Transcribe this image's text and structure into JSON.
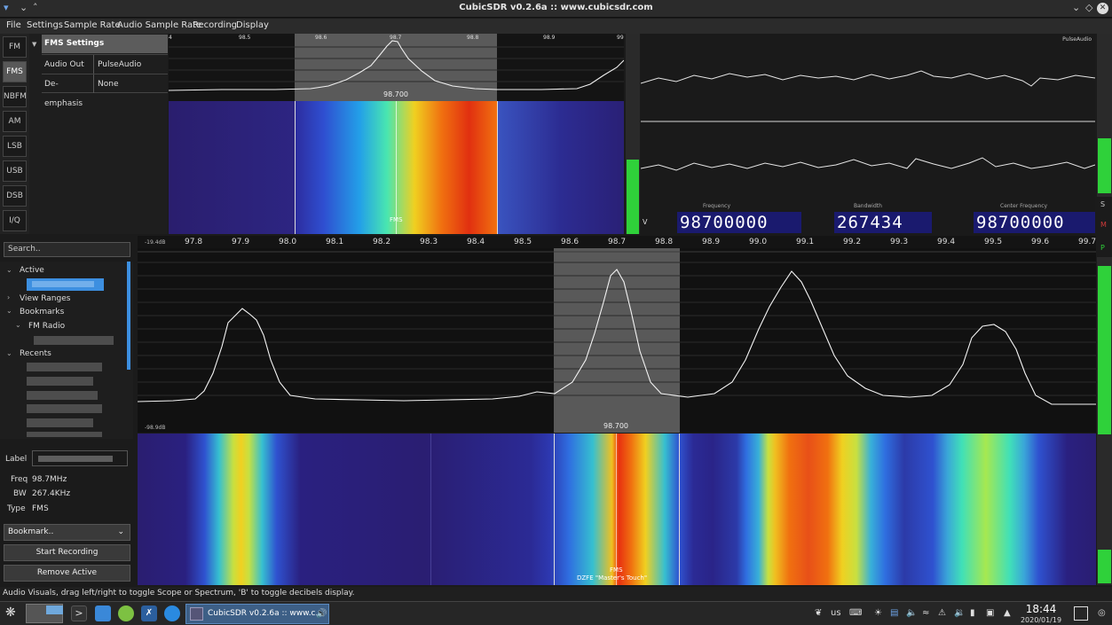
{
  "window": {
    "title": "CubicSDR v0.2.6a :: www.cubicsdr.com"
  },
  "menu": [
    "File",
    "Settings",
    "Sample Rate",
    "Audio Sample Rate",
    "Recording",
    "Display"
  ],
  "modes": [
    {
      "label": "FM",
      "selected": false
    },
    {
      "label": "FMS",
      "selected": true
    },
    {
      "label": "NBFM",
      "selected": false
    },
    {
      "label": "AM",
      "selected": false
    },
    {
      "label": "LSB",
      "selected": false
    },
    {
      "label": "USB",
      "selected": false
    },
    {
      "label": "DSB",
      "selected": false
    },
    {
      "label": "I/Q",
      "selected": false
    }
  ],
  "fms_settings": {
    "title": "FMS Settings",
    "rows": [
      {
        "key": "Audio Out",
        "value": "PulseAudio"
      },
      {
        "key": "De-emphasis",
        "value": "None"
      }
    ]
  },
  "top_spectrum": {
    "ticks": [
      "4",
      "98.5",
      "98.6",
      "98.7",
      "98.8",
      "98.9",
      "99"
    ],
    "selection_label": "98.700",
    "wf_label": "FMS"
  },
  "scope": {
    "label": "PulseAudio"
  },
  "freq_display": {
    "left_label": "V",
    "frequency_label": "Frequency",
    "frequency": "98700000",
    "bandwidth_label": "Bandwidth",
    "bandwidth": "267434",
    "center_label": "Center Frequency",
    "center": "98700000"
  },
  "side_labels": {
    "s": "S",
    "m": "M",
    "p": "P"
  },
  "search": {
    "placeholder": "Search.."
  },
  "tree": {
    "active": "Active",
    "view_ranges": "View Ranges",
    "bookmarks": "Bookmarks",
    "fm_radio": "FM Radio",
    "recents": "Recents"
  },
  "props": {
    "label_key": "Label",
    "freq_key": "Freq",
    "freq_val": "98.7MHz",
    "bw_key": "BW",
    "bw_val": "267.4KHz",
    "type_key": "Type",
    "type_val": "FMS"
  },
  "buttons": {
    "bookmark": "Bookmark..",
    "start_recording": "Start Recording",
    "remove_active": "Remove Active"
  },
  "main_spectrum": {
    "db_top": "-19.4dB",
    "db_bottom": "-98.9dB",
    "ticks": [
      "97.8",
      "97.9",
      "98.0",
      "98.1",
      "98.2",
      "98.3",
      "98.4",
      "98.5",
      "98.6",
      "98.7",
      "98.8",
      "98.9",
      "99.0",
      "99.1",
      "99.2",
      "99.3",
      "99.4",
      "99.5",
      "99.6",
      "99.7"
    ],
    "selection_label": "98.700",
    "wf_label_1": "FMS",
    "wf_label_2": "DZFE \"Master's Touch\""
  },
  "status": "Audio Visuals, drag left/right to toggle Scope or Spectrum, 'B' to toggle decibels display.",
  "taskbar": {
    "app_title": "CubicSDR v0.2.6a :: www.c...",
    "keyboard": "us",
    "time": "18:44",
    "date": "2020/01/19"
  },
  "colors": {
    "accent": "#3d8fe0",
    "digit_bg": "#1a1a6e",
    "meter_green": "#2fd13a"
  }
}
